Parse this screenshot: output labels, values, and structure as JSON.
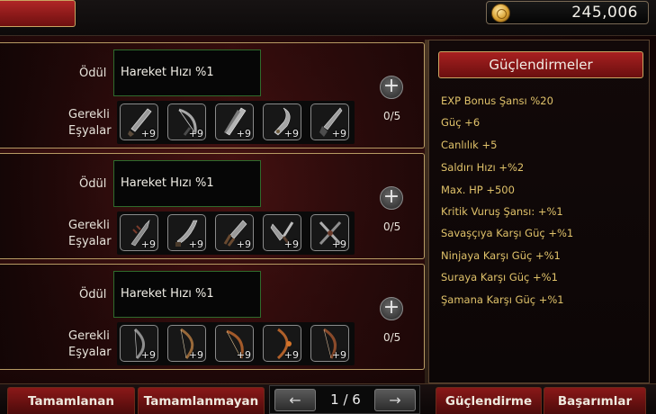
{
  "header": {
    "gold_amount": "245,006",
    "gold_icon": "gold-coin-icon"
  },
  "quests": [
    {
      "reward_label": "Ödül",
      "reward_value": "Hareket Hızı %1",
      "required_label_line1": "Gerekli",
      "required_label_line2": "Eşyalar",
      "progress": "0/5",
      "items": [
        {
          "icon": "sword-icon",
          "level": "+9"
        },
        {
          "icon": "bow-icon",
          "level": "+9"
        },
        {
          "icon": "blade-icon",
          "level": "+9"
        },
        {
          "icon": "glaive-icon",
          "level": "+9"
        },
        {
          "icon": "dagger-icon",
          "level": "+9"
        }
      ]
    },
    {
      "reward_label": "Ödül",
      "reward_value": "Hareket Hızı %1",
      "required_label_line1": "Gerekli",
      "required_label_line2": "Eşyalar",
      "progress": "0/5",
      "items": [
        {
          "icon": "spiked-blade-icon",
          "level": "+9"
        },
        {
          "icon": "curved-blade-icon",
          "level": "+9"
        },
        {
          "icon": "claw-blade-icon",
          "level": "+9"
        },
        {
          "icon": "twin-blade-icon",
          "level": "+9"
        },
        {
          "icon": "crossed-blade-icon",
          "level": "+9"
        }
      ]
    },
    {
      "reward_label": "Ödül",
      "reward_value": "Hareket Hızı %1",
      "required_label_line1": "Gerekli",
      "required_label_line2": "Eşyalar",
      "progress": "0/5",
      "items": [
        {
          "icon": "longbow-icon",
          "level": "+9"
        },
        {
          "icon": "recurve-bow-icon",
          "level": "+9"
        },
        {
          "icon": "fire-bow-icon",
          "level": "+9"
        },
        {
          "icon": "flame-bow-icon",
          "level": "+9"
        },
        {
          "icon": "war-bow-icon",
          "level": "+9"
        }
      ]
    }
  ],
  "sidebar": {
    "title": "Güçlendirmeler",
    "bonuses": [
      "EXP Bonus Şansı %20",
      "Güç +6",
      "Canlılık +5",
      "Saldırı Hızı +%2",
      "Max. HP +500",
      "Kritik Vuruş Şansı: +%1",
      "Savaşçıya Karşı Güç +%1",
      "Ninjaya Karşı Güç +%1",
      "Suraya Karşı Güç +%1",
      "Şamana Karşı Güç +%1"
    ]
  },
  "footer": {
    "tab_completed": "Tamamlanan",
    "tab_incomplete": "Tamamlanmayan",
    "page_indicator": "1 / 6",
    "prev_arrow": "←",
    "next_arrow": "→",
    "tab_boosts": "Güçlendirme",
    "tab_achievements": "Başarımlar"
  },
  "icons": {
    "add": "+"
  },
  "colors": {
    "accent_red": "#a82020",
    "border_gold": "#b69a63",
    "bonus_text": "#e0c26a",
    "reward_border": "#2f6b2c"
  }
}
